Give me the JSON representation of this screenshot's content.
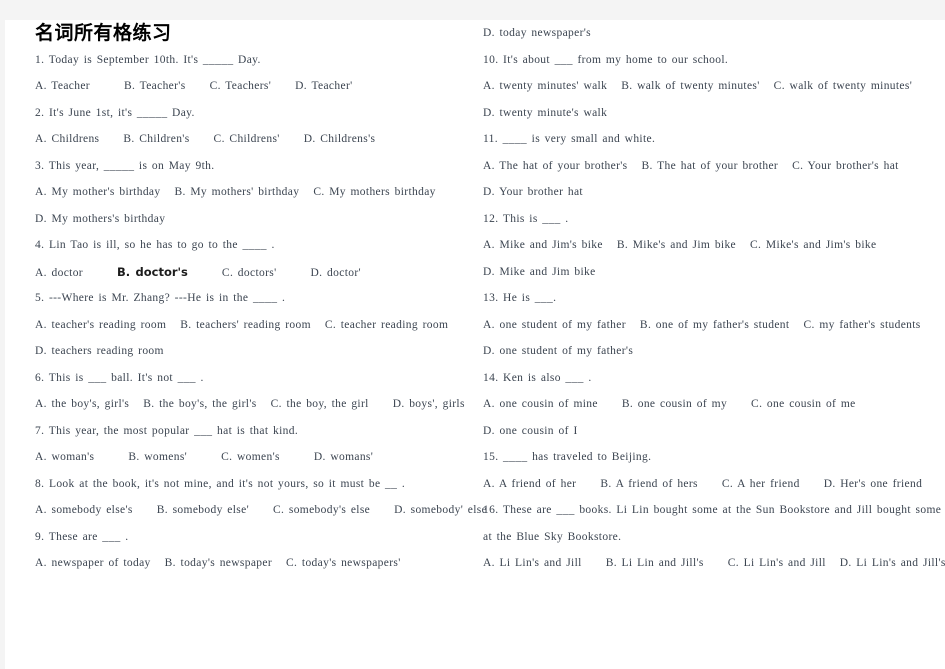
{
  "document": {
    "title": "名词所有格练习",
    "page_background": "#ffffff",
    "viewport_background": "#f4f4f4",
    "text_color": "#3b4450",
    "highlight_color": "#1c1c1c"
  },
  "left_column": {
    "lines": [
      {
        "type": "stem",
        "text": "1. Today is September 10th. It's _____ Day."
      },
      {
        "type": "opts",
        "parts": [
          "A. Teacher",
          "B. Teacher's",
          "C. Teachers'",
          "D. Teacher'"
        ]
      },
      {
        "type": "stem",
        "text": "2. It's June 1st, it's _____ Day."
      },
      {
        "type": "opts",
        "parts": [
          "A. Childrens",
          "B. Children's",
          "C. Childrens'",
          "D. Childrens's"
        ]
      },
      {
        "type": "stem",
        "text": "3. This year, _____ is on May 9th."
      },
      {
        "type": "opts",
        "parts": [
          "A. My mother's birthday",
          "B. My mothers' birthday",
          "C. My mothers birthday"
        ]
      },
      {
        "type": "opts",
        "parts": [
          "D. My mothers's birthday"
        ]
      },
      {
        "type": "stem",
        "text": "4. Lin Tao is ill, so he has to go to the ____ ."
      },
      {
        "type": "opts",
        "parts": [
          "A. doctor",
          "B. doctor's",
          "C. doctors'",
          "D. doctor'"
        ],
        "highlight_index": 1
      },
      {
        "type": "stem",
        "text": "5. ---Where is Mr. Zhang? ---He is in the ____ ."
      },
      {
        "type": "opts",
        "parts": [
          "A. teacher's reading room",
          "B. teachers' reading room",
          "C. teacher reading room"
        ]
      },
      {
        "type": "opts",
        "parts": [
          "D. teachers reading room"
        ]
      },
      {
        "type": "stem",
        "text": "6. This is ___ ball. It's not ___ ."
      },
      {
        "type": "opts",
        "parts": [
          "A. the boy's, girl's",
          "B. the boy's, the girl's",
          "C. the boy, the girl",
          "D. boys', girls"
        ]
      },
      {
        "type": "stem",
        "text": "7. This year, the most popular ___ hat is that kind."
      },
      {
        "type": "opts",
        "parts": [
          "A. woman's",
          "B. womens'",
          "C. women's",
          "D. womans'"
        ]
      },
      {
        "type": "stem",
        "text": "8. Look at the book, it's not mine, and it's not yours, so it must be __ ."
      },
      {
        "type": "opts",
        "parts": [
          "A. somebody else's",
          "B. somebody else'",
          "C. somebody's else",
          "D. somebody' else"
        ]
      },
      {
        "type": "stem",
        "text": "9. These are ___ ."
      },
      {
        "type": "opts",
        "parts": [
          "A. newspaper of today",
          "B. today's newspaper",
          "C. today's newspapers'"
        ]
      }
    ]
  },
  "right_column": {
    "lines": [
      {
        "type": "opts",
        "parts": [
          "D. today newspaper's"
        ]
      },
      {
        "type": "stem",
        "text": "10. It's about ___ from my home to our school."
      },
      {
        "type": "opts",
        "parts": [
          "A. twenty minutes' walk",
          "B. walk of twenty minutes'",
          "C. walk of twenty minutes'"
        ]
      },
      {
        "type": "opts",
        "parts": [
          "D. twenty minute's walk"
        ]
      },
      {
        "type": "stem",
        "text": "11. ____ is very small and white."
      },
      {
        "type": "opts",
        "parts": [
          "A. The hat of your brother's",
          "B. The hat of your brother",
          "C. Your brother's hat"
        ]
      },
      {
        "type": "opts",
        "parts": [
          "D. Your brother hat"
        ]
      },
      {
        "type": "stem",
        "text": "12. This is ___ ."
      },
      {
        "type": "opts",
        "parts": [
          "A. Mike and Jim's bike",
          "B. Mike's and Jim bike",
          "C. Mike's and Jim's bike"
        ]
      },
      {
        "type": "opts",
        "parts": [
          "D. Mike and Jim bike"
        ]
      },
      {
        "type": "stem",
        "text": "13. He is ___."
      },
      {
        "type": "opts",
        "parts": [
          "A. one student of my father",
          "B. one of my father's student",
          "C. my father's students"
        ]
      },
      {
        "type": "opts",
        "parts": [
          "D. one student of my father's"
        ]
      },
      {
        "type": "stem",
        "text": "14. Ken is also ___ ."
      },
      {
        "type": "opts",
        "parts": [
          "A. one cousin of mine",
          "B. one cousin of my",
          "C. one cousin of me"
        ]
      },
      {
        "type": "opts",
        "parts": [
          "D. one cousin of I"
        ]
      },
      {
        "type": "stem",
        "text": "15. ____ has traveled to Beijing."
      },
      {
        "type": "opts",
        "parts": [
          "A. A friend of her",
          "B. A friend of hers",
          "C. A her friend",
          "D. Her's one friend"
        ]
      },
      {
        "type": "stem",
        "text": "16. These are ___ books. Li Lin bought some at the Sun Bookstore and Jill bought some"
      },
      {
        "type": "stem",
        "text": "at the Blue Sky Bookstore."
      },
      {
        "type": "opts",
        "parts": [
          "A. Li Lin's and Jill",
          "B. Li Lin and Jill's",
          "C. Li Lin's and Jill",
          "D. Li Lin's and Jill's"
        ]
      }
    ]
  }
}
